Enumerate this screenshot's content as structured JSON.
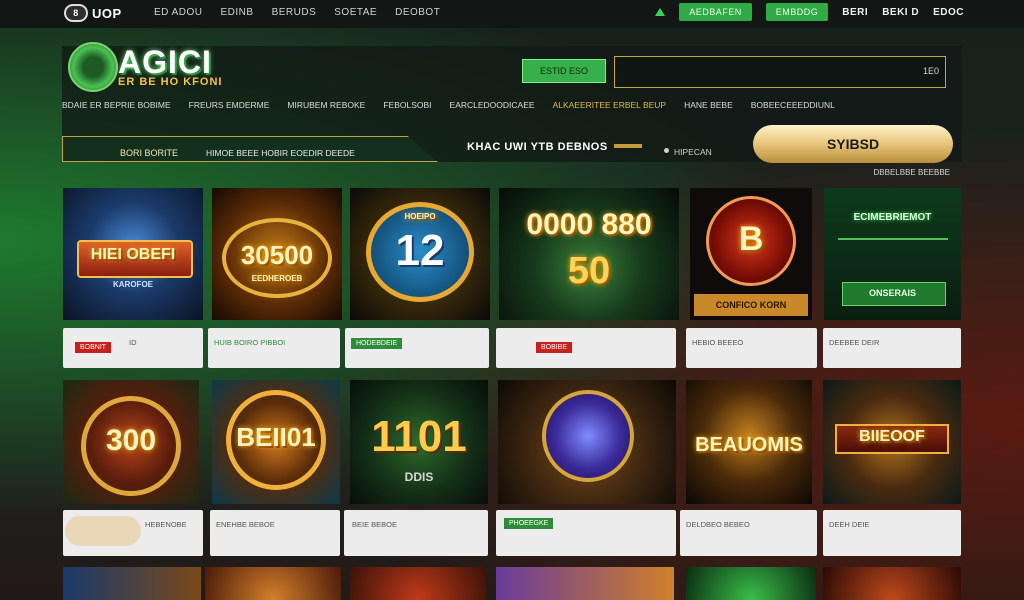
{
  "nav": {
    "brand": "UOP",
    "brand_mark": "8",
    "links": [
      "ED ADOU",
      "EDINB",
      "BERUDS",
      "SOETAE",
      "DEOBOT"
    ],
    "button_1": "AEDBAFEN",
    "button_2": "EMBDDG",
    "account_1": "BERI",
    "account_2": "BEKI D",
    "account_3": "EDOC",
    "accent": "#2faa45"
  },
  "header": {
    "logo_title": "AGICI",
    "logo_sub": "ER BE HO KFONI",
    "cta_label": "ESTID ESO",
    "search_value": "1E0"
  },
  "categories": [
    "BDAIE ER BEPRIE BOBIME",
    "FREURS EMDERME",
    "MIRUBEM REBOKE",
    "FEBOLSOBI",
    "EARCLEDOODICAEE",
    "ALKAEERITEE ERBEL BEUP",
    "HANE BEBE",
    "BOBEECEEEDDIUNL"
  ],
  "promo": {
    "left_a": "BORI BORITE",
    "left_b": "HIMOE BEEE HOBIR EOEDIR DEEDE",
    "title": "KHAC UWI YTB DEBNOS",
    "right": "HIPECAN",
    "signin_label": "SYIBSD",
    "note": "DBBELBBE BEEBBE"
  },
  "games_row1": [
    {
      "title": "HIEI OBEFI",
      "sub": "KAROFOE",
      "card_tag": "BOBNIT",
      "card_text": "ID",
      "tag_color": "red"
    },
    {
      "title": "30500",
      "sub": "EEDHEROEB",
      "card_tag": "",
      "card_text": "HUIB BOIRO PIBBOI",
      "tag_color": ""
    },
    {
      "title": "12",
      "sub": "HOEIPO",
      "card_tag": "HODEBDEIE",
      "card_text": "",
      "tag_color": "green"
    },
    {
      "title": "0000 880",
      "sub": "50",
      "card_tag": "BOBIBE",
      "card_text": "",
      "tag_color": "red"
    },
    {
      "title": "B",
      "sub": "CONFICO KORN",
      "card_tag": "",
      "card_text": "HEBIO BEEEO",
      "tag_color": ""
    },
    {
      "title": "ECIMEBRIEMOT",
      "sub": "ONSERAIS",
      "card_tag": "",
      "card_text": "DEEBEE DEIR",
      "tag_color": ""
    }
  ],
  "games_row2": [
    {
      "title": "300",
      "card_text": "HEBENOBE"
    },
    {
      "title": "BEII01",
      "card_text": "ENEHBE BEBOE"
    },
    {
      "title": "1101",
      "sub": "DDIS",
      "card_text": "BEIE BEBOE"
    },
    {
      "title": "",
      "card_text": "PHOEEGKE"
    },
    {
      "title": "BEAUOMIS",
      "card_text": "DELDBEO BEBEO"
    },
    {
      "title": "BIIEOOF",
      "card_text": "DEEH DEIE"
    }
  ]
}
